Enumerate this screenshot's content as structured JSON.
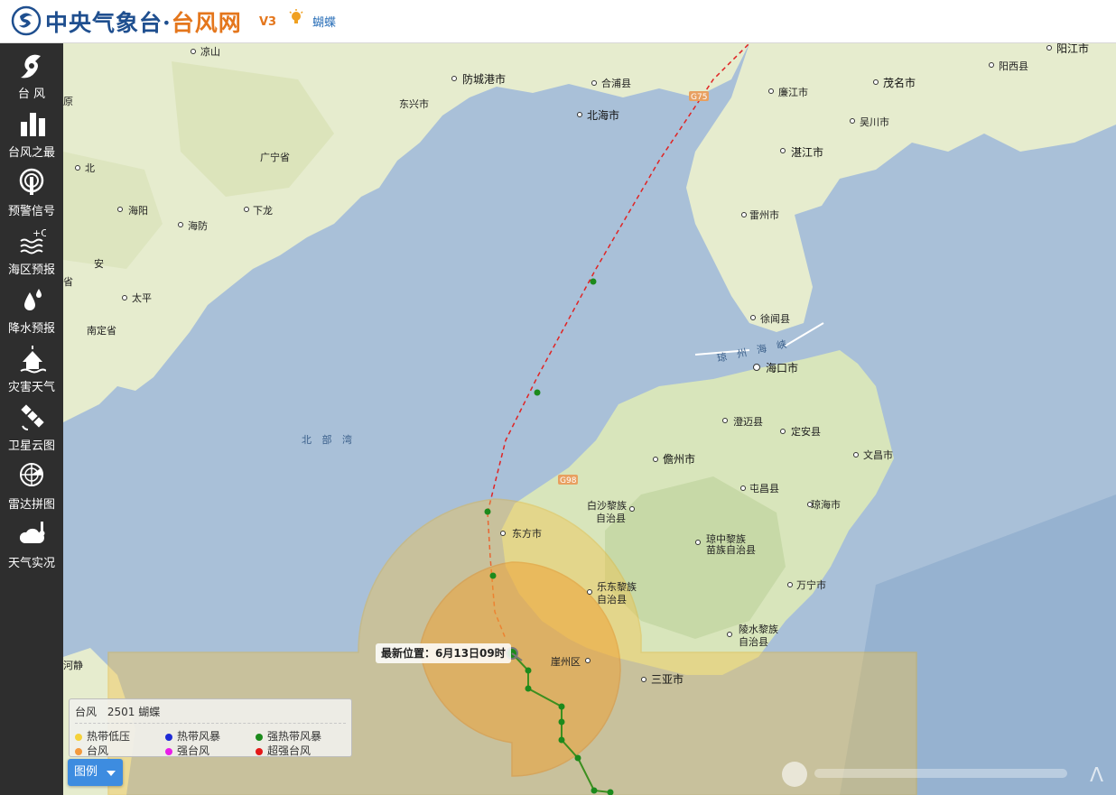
{
  "header": {
    "site_name_main": "中央气象台·",
    "site_name_accent": "台风网",
    "version": "V3",
    "current_typhoon": "蝴蝶"
  },
  "sidebar": {
    "items": [
      {
        "label": "台 风",
        "icon": "typhoon-icon"
      },
      {
        "label": "台风之最",
        "icon": "bar-chart-icon"
      },
      {
        "label": "预警信号",
        "icon": "warning-signal-icon"
      },
      {
        "label": "海区预报",
        "icon": "sea-forecast-icon"
      },
      {
        "label": "降水预报",
        "icon": "rain-drop-icon"
      },
      {
        "label": "灾害天气",
        "icon": "severe-weather-icon"
      },
      {
        "label": "卫星云图",
        "icon": "satellite-icon"
      },
      {
        "label": "雷达拼图",
        "icon": "radar-icon"
      },
      {
        "label": "天气实况",
        "icon": "weather-observation-icon"
      }
    ]
  },
  "map": {
    "place_labels": {
      "liangshan": "凉山",
      "fangchenggang": "防城港市",
      "hepu": "合浦县",
      "beihai": "北海市",
      "dongxing": "东兴市",
      "lianjiang": "廉江市",
      "maoming": "茂名市",
      "yangjiang": "阳江市",
      "yangxi": "阳西县",
      "wuchuan": "吴川市",
      "zhanjiang": "湛江市",
      "leizhou": "雷州市",
      "xuwen": "徐闻县",
      "haikou": "海口市",
      "chengmai": "澄迈县",
      "ding_an": "定安县",
      "danzhou": "儋州市",
      "wenchang": "文昌市",
      "tunchang": "屯昌县",
      "qionghai": "琼海市",
      "baisha": "白沙黎族\n自治县",
      "qiongzhong": "琼中黎族\n苗族自治县",
      "wanning": "万宁市",
      "lingshui": "陵水黎族\n自治县",
      "dongfang": "东方市",
      "ledong": "乐东黎族\n自治县",
      "yazhou": "崖州区",
      "sanya": "三亚市",
      "guangning": "广宁省",
      "bac": "北",
      "haiyang": "海阳",
      "haiphong": "海防",
      "halong": "下龙",
      "thaibinh": "太平",
      "namdinh": "南定省",
      "an": "安",
      "province_edge": "省",
      "yuan": "原",
      "heam": "河静"
    },
    "sea_labels": {
      "beibu_gulf": "北 部 湾",
      "qiongzhou_strait": "琼 州 海 峡"
    },
    "road_labels": {
      "g75": "G75",
      "g98": "G98"
    },
    "latest_position": "最新位置：6月13日09时"
  },
  "legend": {
    "typhoon_label": "台风",
    "typhoon_id": "2501 蝴蝶",
    "items": [
      {
        "label": "热带低压",
        "color": "#f5d23a"
      },
      {
        "label": "热带风暴",
        "color": "#1f2bd6"
      },
      {
        "label": "强热带风暴",
        "color": "#1c8a1c"
      },
      {
        "label": "台风",
        "color": "#f39a3d"
      },
      {
        "label": "强台风",
        "color": "#e81ee8"
      },
      {
        "label": "超强台风",
        "color": "#e41818"
      }
    ],
    "toggle_label": "图例"
  },
  "colors": {
    "sidebar_bg": "#2e2e2e",
    "header_title": "#1f4f8f",
    "accent": "#e4761c",
    "track_segment": "#3c8f1f",
    "forecast_line": "#e02424",
    "wind_circle_outer": "#f3c34a",
    "wind_circle_inner": "#f0a030"
  }
}
